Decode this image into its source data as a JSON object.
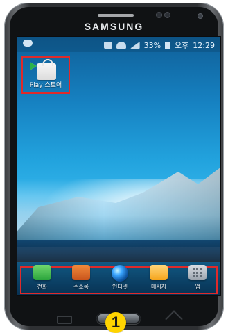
{
  "device": {
    "brand_text": "SAMSUNG"
  },
  "status_bar": {
    "battery_percent_text": "33%",
    "ampm_text": "오후",
    "time_text": "12:29"
  },
  "home_screen": {
    "highlighted_app": {
      "label": "Play 스토어",
      "icon_name": "play-store-icon"
    },
    "dock": {
      "items": [
        {
          "label": "전화",
          "icon_name": "phone-icon"
        },
        {
          "label": "주소록",
          "icon_name": "contacts-icon"
        },
        {
          "label": "인터넷",
          "icon_name": "internet-icon"
        },
        {
          "label": "메시지",
          "icon_name": "messages-icon"
        },
        {
          "label": "앱",
          "icon_name": "apps-icon"
        }
      ]
    }
  },
  "annotation": {
    "step_number": "1",
    "highlight_color": "#e02a2a",
    "badge_color": "#ffd400"
  }
}
